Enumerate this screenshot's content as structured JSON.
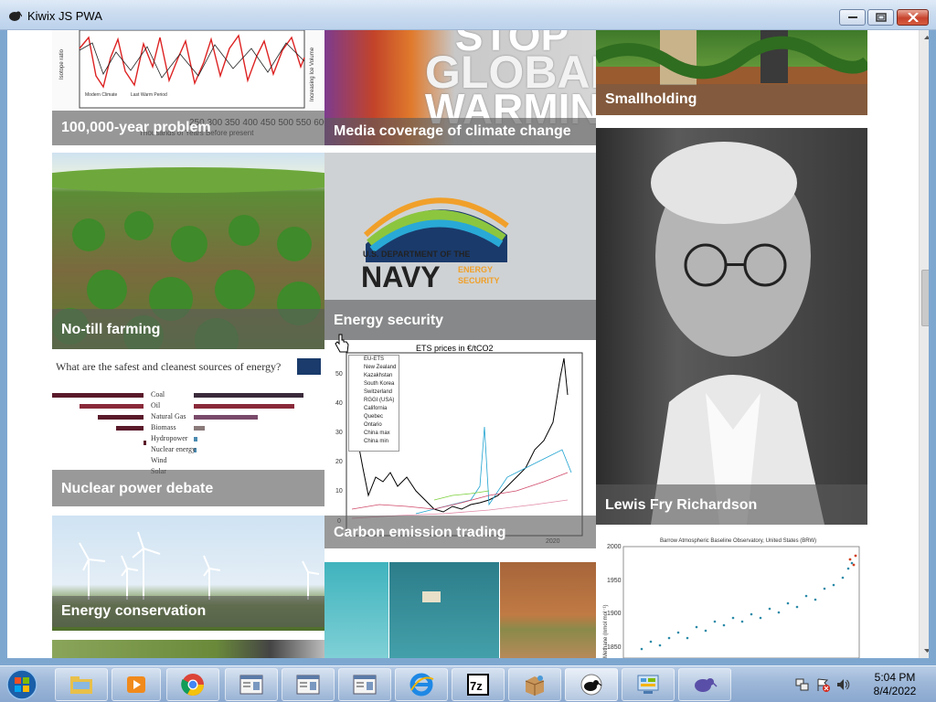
{
  "window": {
    "title": "Kiwix JS PWA"
  },
  "tiles": [
    {
      "label": "100,000-year problem"
    },
    {
      "label": "Media coverage of climate change",
      "image_text": [
        "STOP",
        "GLOBAL",
        "WARMING"
      ]
    },
    {
      "label": "Smallholding"
    },
    {
      "label": "No-till farming"
    },
    {
      "label": "Energy security",
      "image_text": [
        "U.S. DEPARTMENT OF THE",
        "NAVY",
        "ENERGY",
        "SECURITY"
      ]
    },
    {
      "label": "Lewis Fry Richardson"
    },
    {
      "label": "Nuclear power debate",
      "image_text": {
        "title": "What are the safest and cleanest sources of energy?",
        "rows": [
          "Coal",
          "Oil",
          "Natural Gas",
          "Biomass",
          "Hydropower",
          "Nuclear energy",
          "Wind",
          "Solar"
        ]
      }
    },
    {
      "label": "Carbon emission trading",
      "chart_title": "ETS prices in €/tCO2",
      "legend": [
        "EU-ETS",
        "New Zealand",
        "Kazakhstan",
        "South Korea",
        "Switzerland",
        "RGGI (USA)",
        "California",
        "Quebec",
        "Ontario",
        "China max",
        "China min"
      ],
      "yticks": [
        "0",
        "10",
        "20",
        "30",
        "40",
        "50"
      ],
      "xticks": [
        "2020"
      ]
    },
    {
      "label": "Energy conservation"
    },
    {
      "label": ""
    },
    {
      "label": "",
      "chart_title": "Barrow Atmospheric Baseline Observatory, United States (BRW)",
      "ylabel": "Methane (nmol mol⁻¹)",
      "yticks": [
        "1850",
        "1900",
        "1950",
        "2000"
      ]
    }
  ],
  "taskbar": {
    "clock_time": "5:04 PM",
    "clock_date": "8/4/2022",
    "items": [
      "file-explorer",
      "media-player",
      "chrome",
      "document-1",
      "document-2",
      "document-3",
      "internet-explorer",
      "7-zip",
      "package",
      "kiwix",
      "control-panel",
      "kiwix-2"
    ]
  }
}
